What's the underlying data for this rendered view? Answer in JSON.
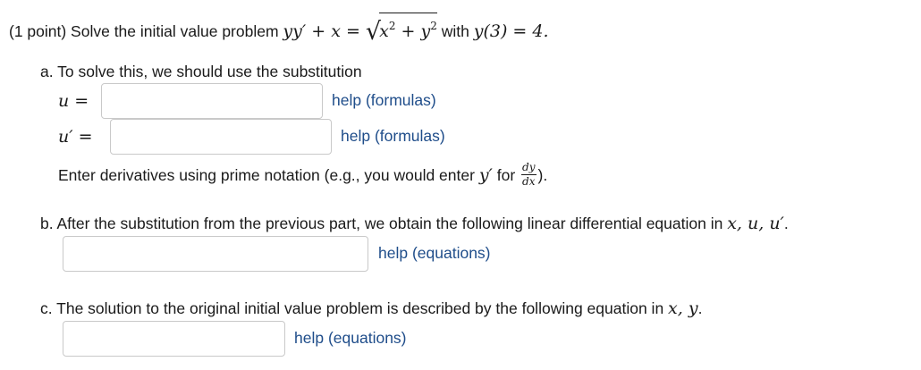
{
  "problem": {
    "prefix": "(1 point) Solve the initial value problem ",
    "eq_lhs": "yy′ + x = ",
    "sqrt_x": "x",
    "sqrt_plus_y": " + y",
    "sq": "2",
    "with_text": " with ",
    "initial": "y(3) = 4."
  },
  "part_a": {
    "intro": "a. To solve this, we should use the substitution",
    "u_label": "u =",
    "u_value": "",
    "uprime_label": "u′ =",
    "uprime_value": "",
    "help_formulas": "help (formulas)",
    "note_prefix": "Enter derivatives using prime notation (e.g., you would enter ",
    "note_yprime": "y′",
    "note_for": " for ",
    "frac_num": "dy",
    "frac_den": "dx",
    "note_suffix": ")."
  },
  "part_b": {
    "text": "b. After the substitution from the previous part, we obtain the following linear differential equation in ",
    "vars": "x, u, u′",
    "end": ".",
    "value": "",
    "help_equations": "help (equations)"
  },
  "part_c": {
    "text": "c. The solution to the original initial value problem is described by the following equation in ",
    "vars": "x, y",
    "end": ".",
    "value": "",
    "help_equations": "help (equations)"
  },
  "colors": {
    "text": "#1a1a1a",
    "link": "#1f4d8a",
    "input_border": "#c9c9c9"
  }
}
